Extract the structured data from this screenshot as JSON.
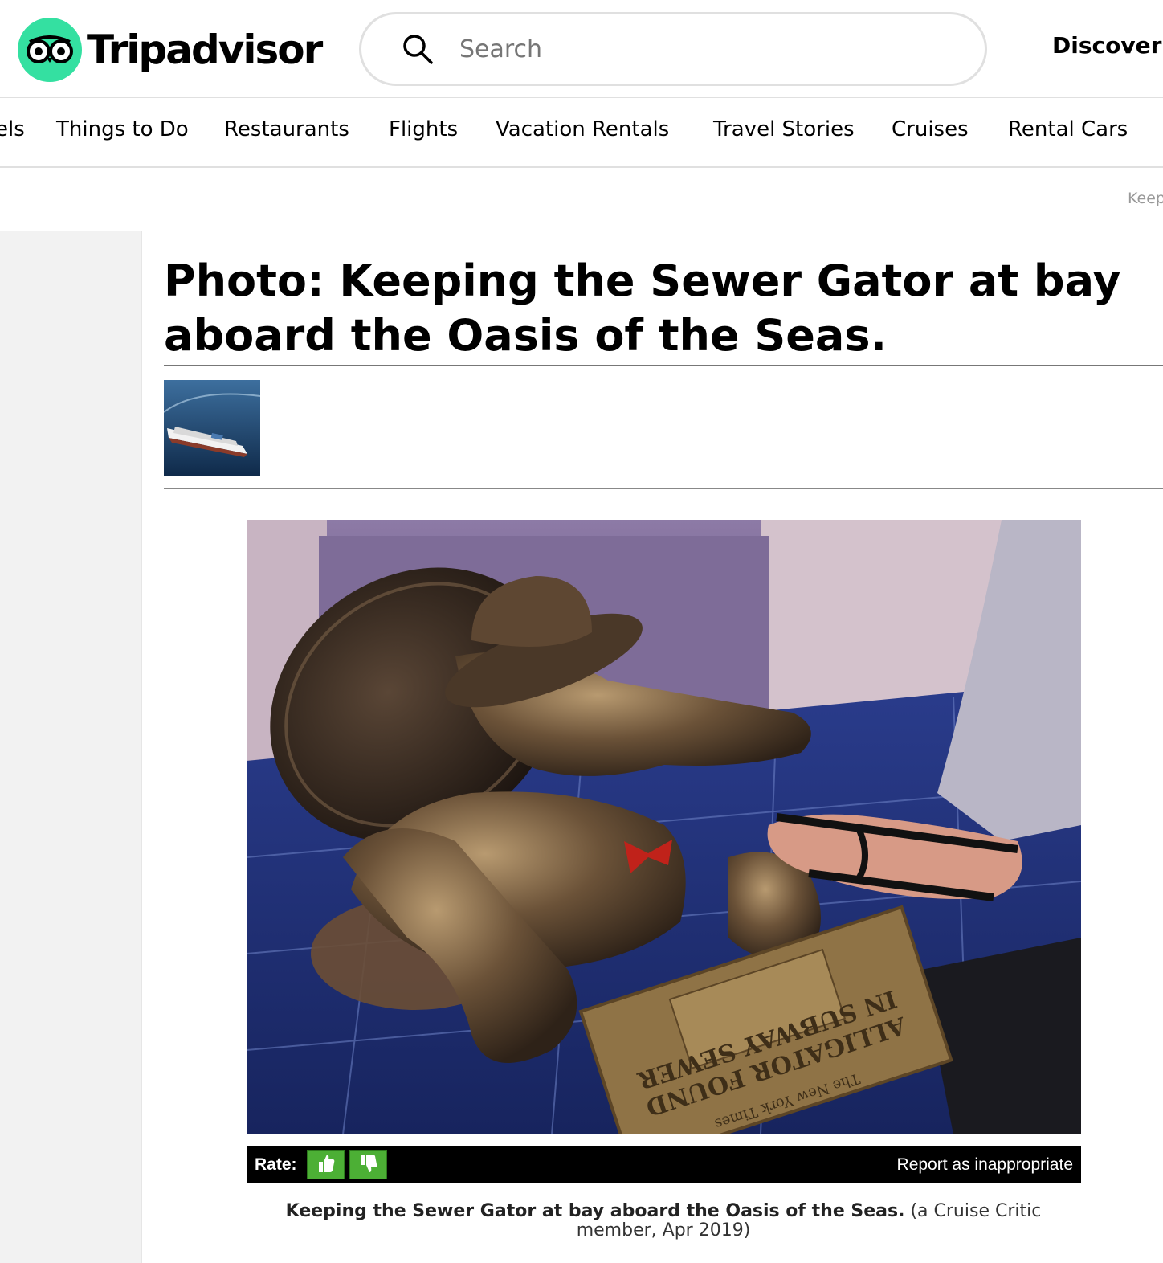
{
  "header": {
    "logo_text": "Tripadvisor",
    "search_placeholder": "Search",
    "discover_label": "Discover"
  },
  "nav": {
    "items": [
      {
        "label": "els"
      },
      {
        "label": "Things to Do"
      },
      {
        "label": "Restaurants"
      },
      {
        "label": "Flights"
      },
      {
        "label": "Vacation Rentals"
      },
      {
        "label": "Travel Stories"
      },
      {
        "label": "Cruises"
      },
      {
        "label": "Rental Cars"
      }
    ]
  },
  "breadcrumb": {
    "text": "Keep"
  },
  "page": {
    "title": "Photo: Keeping the Sewer Gator at bay aboard the Oasis of the Seas."
  },
  "photo": {
    "plaque_line1": "ALLIGATOR FOUND",
    "plaque_line2": "IN SUBWAY SEWER",
    "plaque_masthead": "The New York Times"
  },
  "rate_bar": {
    "rate_label": "Rate:",
    "report_label": "Report as inappropriate"
  },
  "caption": {
    "bold": "Keeping the Sewer Gator at bay aboard the Oasis of the Seas.",
    "meta": " (a Cruise Critic member, Apr 2019)"
  },
  "colors": {
    "brand_green": "#34e0a1",
    "rate_green": "#4caf35"
  }
}
